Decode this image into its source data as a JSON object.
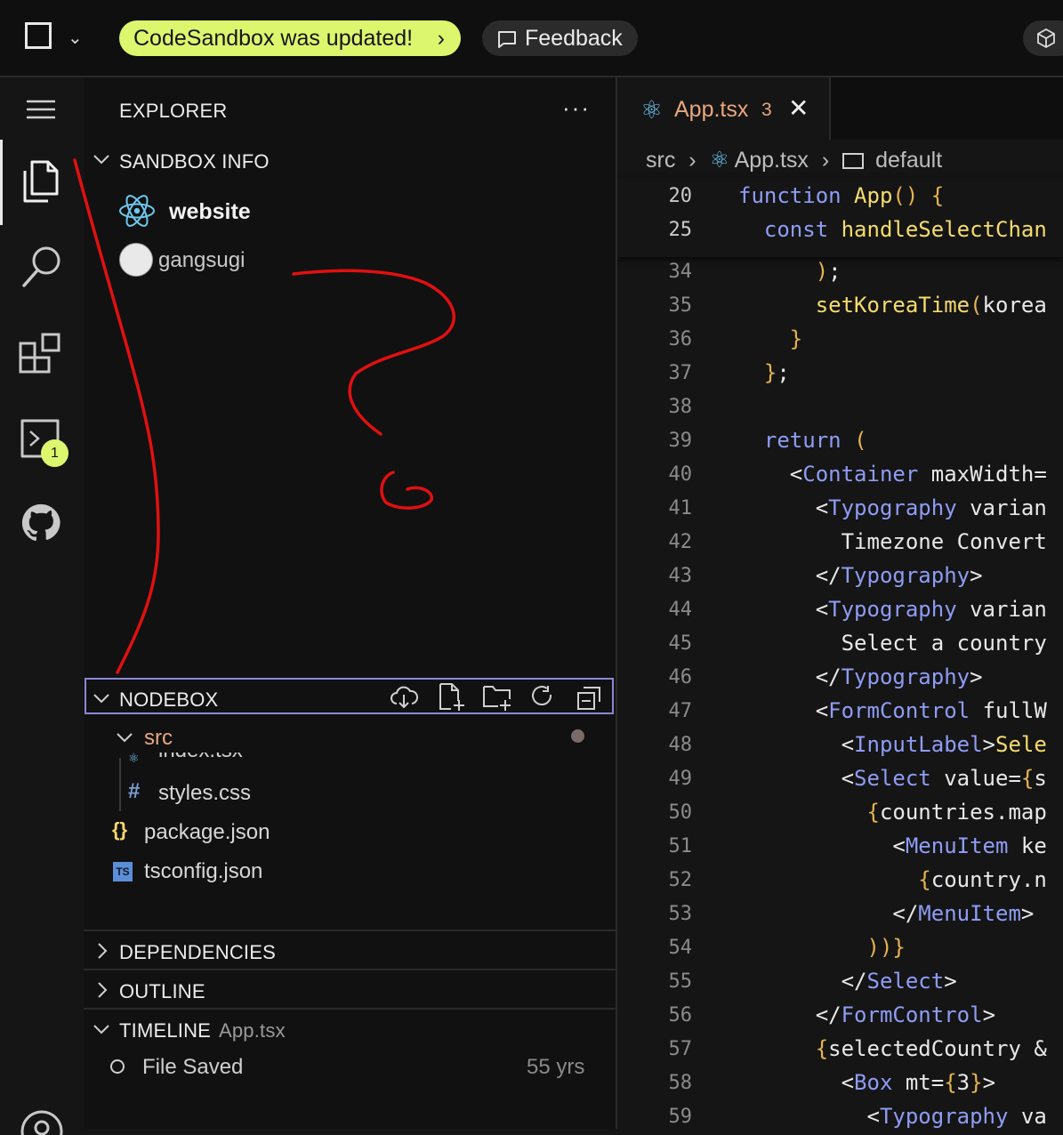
{
  "topbar": {
    "update_label": "CodeSandbox was updated!",
    "feedback_label": "Feedback"
  },
  "activity": {
    "terminal_badge": "1"
  },
  "explorer": {
    "title": "EXPLORER",
    "more": "···",
    "sandbox_info": {
      "title": "SANDBOX INFO",
      "name": "website",
      "user": "gangsugi"
    },
    "nodebox": {
      "title": "NODEBOX",
      "folder": "src",
      "files_in_src": [
        "index.tsx",
        "styles.css"
      ],
      "files_root": [
        "package.json",
        "tsconfig.json"
      ]
    },
    "dependencies": "DEPENDENCIES",
    "outline": "OUTLINE",
    "timeline": {
      "title": "TIMELINE",
      "file": "App.tsx",
      "entry_label": "File Saved",
      "entry_age": "55 yrs"
    }
  },
  "editor": {
    "tab": {
      "label": "App.tsx",
      "problems": "3",
      "close": "✕"
    },
    "breadcrumb": {
      "folder": "src",
      "file": "App.tsx",
      "symbol": "default"
    },
    "sticky": [
      {
        "num": "20",
        "text": "function App() {"
      },
      {
        "num": "25",
        "text": "  const handleSelectChan"
      }
    ],
    "lines": [
      {
        "num": "34",
        "text": "      );"
      },
      {
        "num": "35",
        "text": "      setKoreaTime(korea"
      },
      {
        "num": "36",
        "text": "    }"
      },
      {
        "num": "37",
        "text": "  };"
      },
      {
        "num": "38",
        "text": ""
      },
      {
        "num": "39",
        "text": "  return ("
      },
      {
        "num": "40",
        "text": "    <Container maxWidth="
      },
      {
        "num": "41",
        "text": "      <Typography varian"
      },
      {
        "num": "42",
        "text": "        Timezone Convert"
      },
      {
        "num": "43",
        "text": "      </Typography>"
      },
      {
        "num": "44",
        "text": "      <Typography varian"
      },
      {
        "num": "45",
        "text": "        Select a country"
      },
      {
        "num": "46",
        "text": "      </Typography>"
      },
      {
        "num": "47",
        "text": "      <FormControl fullW"
      },
      {
        "num": "48",
        "text": "        <InputLabel>Sele"
      },
      {
        "num": "49",
        "text": "        <Select value={s"
      },
      {
        "num": "50",
        "text": "          {countries.map"
      },
      {
        "num": "51",
        "text": "            <MenuItem ke"
      },
      {
        "num": "52",
        "text": "              {country.n"
      },
      {
        "num": "53",
        "text": "            </MenuItem>"
      },
      {
        "num": "54",
        "text": "          ))}"
      },
      {
        "num": "55",
        "text": "        </Select>"
      },
      {
        "num": "56",
        "text": "      </FormControl>"
      },
      {
        "num": "57",
        "text": "      {selectedCountry &"
      },
      {
        "num": "58",
        "text": "        <Box mt={3}>"
      },
      {
        "num": "59",
        "text": "          <Typography va"
      }
    ]
  },
  "colors": {
    "accent": "#dcf76e",
    "highlight_border": "#8c86d8",
    "tab_label": "#e9a77f",
    "annotation": "#e01010"
  }
}
